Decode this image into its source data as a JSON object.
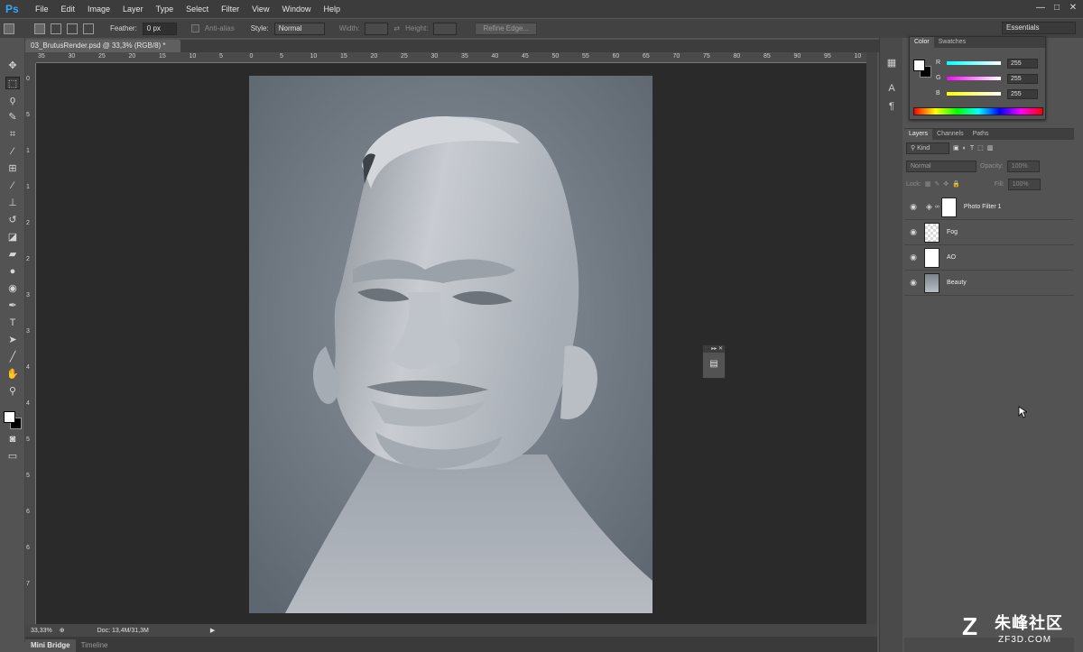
{
  "app": {
    "logo": "Ps",
    "accent_color": "#31a8ff"
  },
  "menu": [
    "File",
    "Edit",
    "Image",
    "Layer",
    "Type",
    "Select",
    "Filter",
    "View",
    "Window",
    "Help"
  ],
  "window_controls": {
    "minimize": "—",
    "restore": "□",
    "close": "✕"
  },
  "options": {
    "feather_label": "Feather:",
    "feather_value": "0 px",
    "antialias_label": "Anti-alias",
    "style_label": "Style:",
    "style_value": "Normal",
    "width_label": "Width:",
    "height_label": "Height:",
    "refine_label": "Refine Edge...",
    "workspace": "Essentials"
  },
  "document": {
    "tab_title": "03_BrutusRender.psd @ 33,3% (RGB/8) *",
    "zoom": "33,33%",
    "doc_info": "Doc: 13,4M/31,3M"
  },
  "ruler_top_labels": [
    "35",
    "30",
    "25",
    "20",
    "15",
    "10",
    "5",
    "0",
    "5",
    "10",
    "15",
    "20",
    "25",
    "30",
    "35",
    "40",
    "45",
    "50",
    "55",
    "60",
    "65",
    "70",
    "75",
    "80",
    "85",
    "90",
    "95",
    "10"
  ],
  "ruler_left_labels": [
    "0",
    "5",
    "1",
    "1",
    "2",
    "2",
    "3",
    "3",
    "4",
    "4",
    "5",
    "5",
    "6",
    "6",
    "7"
  ],
  "bottom_tabs": {
    "mini_bridge": "Mini Bridge",
    "timeline": "Timeline"
  },
  "color_panel": {
    "tab_color": "Color",
    "tab_swatches": "Swatches",
    "r_label": "R",
    "r_value": "255",
    "g_label": "G",
    "g_value": "255",
    "b_label": "B",
    "b_value": "255"
  },
  "layers_panel": {
    "tabs": [
      "Layers",
      "Channels",
      "Paths"
    ],
    "kind_label": "Kind",
    "blend_mode": "Normal",
    "opacity_label": "Opacity:",
    "opacity_value": "100%",
    "lock_label": "Lock:",
    "fill_label": "Fill:",
    "fill_value": "100%",
    "layers": [
      {
        "name": "Photo Filter 1",
        "type": "adjustment"
      },
      {
        "name": "Fog",
        "type": "transparent"
      },
      {
        "name": "AO",
        "type": "white"
      },
      {
        "name": "Beauty",
        "type": "image"
      }
    ]
  },
  "watermark": {
    "mark": "Z",
    "text_cn": "朱峰社区",
    "url": "ZF3D.COM"
  }
}
